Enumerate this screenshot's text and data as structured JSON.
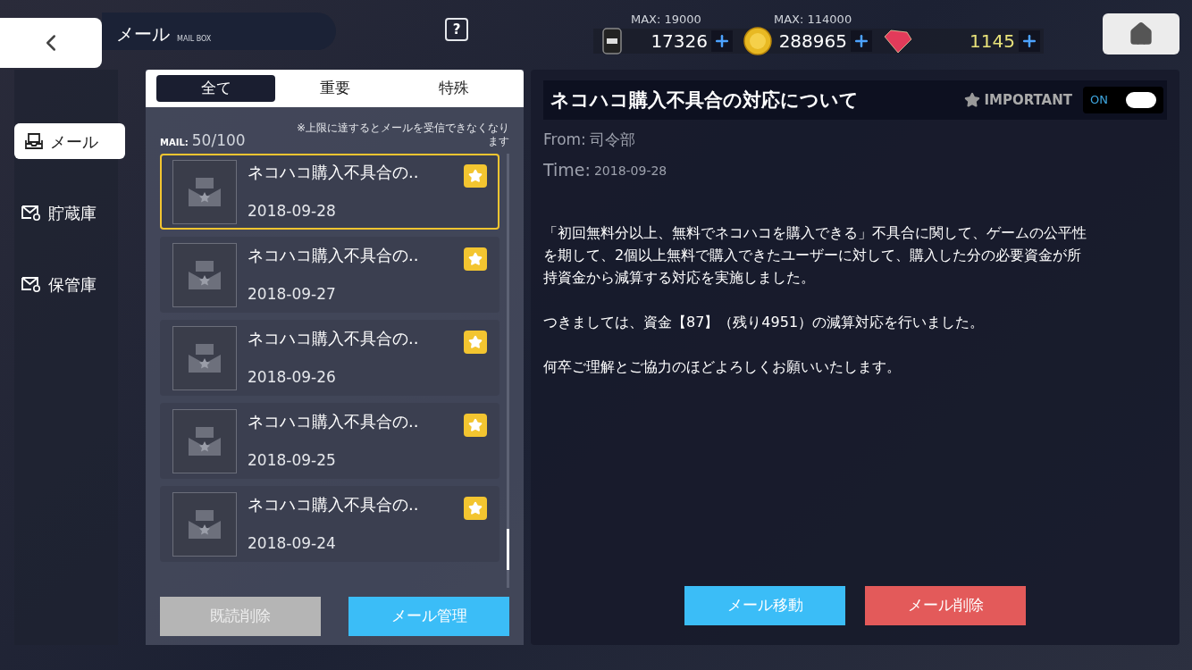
{
  "header": {
    "title": "メール",
    "subtitle": "MAIL BOX",
    "help": "?"
  },
  "resources": [
    {
      "kind": "fuel",
      "max": "MAX: 19000",
      "amount": "17326"
    },
    {
      "kind": "coin",
      "max": "MAX: 114000",
      "amount": "288965"
    },
    {
      "kind": "gem",
      "amount": "1145"
    }
  ],
  "sidebar": {
    "items": [
      {
        "label": "メール",
        "selected": true,
        "kind": "inbox"
      },
      {
        "label": "貯蔵庫",
        "selected": false,
        "kind": "storage"
      },
      {
        "label": "保管庫",
        "selected": false,
        "kind": "archive"
      }
    ]
  },
  "tabs": [
    {
      "label": "全て",
      "selected": true
    },
    {
      "label": "重要",
      "selected": false
    },
    {
      "label": "特殊",
      "selected": false
    }
  ],
  "mail_count": {
    "label": "MAIL:",
    "value": "50/100"
  },
  "notice": "※上限に達するとメールを受信できなくなります",
  "mails": [
    {
      "title": "ネコハコ購入不具合の..",
      "date": "2018-09-28",
      "selected": true,
      "important": true
    },
    {
      "title": "ネコハコ購入不具合の..",
      "date": "2018-09-27",
      "selected": false,
      "important": true
    },
    {
      "title": "ネコハコ購入不具合の..",
      "date": "2018-09-26",
      "selected": false,
      "important": true
    },
    {
      "title": "ネコハコ購入不具合の..",
      "date": "2018-09-25",
      "selected": false,
      "important": true
    },
    {
      "title": "ネコハコ購入不具合の..",
      "date": "2018-09-24",
      "selected": false,
      "important": true
    }
  ],
  "list_buttons": [
    {
      "label": "既読削除",
      "disabled": true
    },
    {
      "label": "メール管理",
      "disabled": false
    }
  ],
  "detail": {
    "title": "ネコハコ購入不具合の対応について",
    "important_label": "IMPORTANT",
    "toggle": {
      "label": "ON",
      "on": true
    },
    "from_label": "From:",
    "from": "司令部",
    "time_label": "Time:",
    "time": "2018-09-28",
    "body": [
      "「初回無料分以上、無料でネコハコを購入できる」不具合に関して、ゲームの公平性を期して、2個以上無料で購入できたユーザーに対して、購入した分の必要資金が所持資金から減算する対応を実施しました。",
      "つきましては、資金【87】（残り4951）の減算対応を行いました。",
      "何卒ご理解とご協力のほどよろしくお願いいたします。"
    ],
    "buttons": [
      {
        "label": "メール移動",
        "kind": "move"
      },
      {
        "label": "メール削除",
        "kind": "delete"
      }
    ]
  }
}
